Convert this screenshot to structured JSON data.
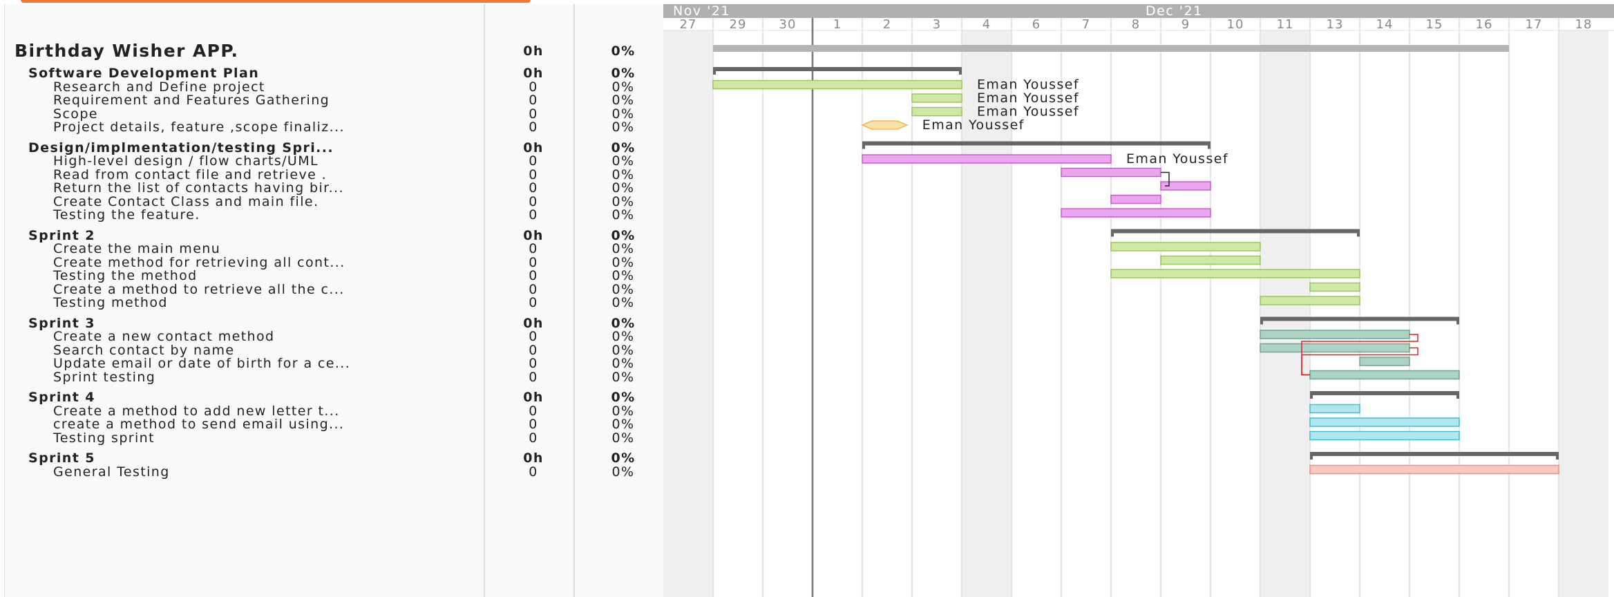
{
  "colors": {
    "summary": "#666666",
    "project_bar": "#b4b4b4",
    "green": "#cfe8a5",
    "green_border": "#97c85a",
    "pink": "#eba5ee",
    "pink_border": "#c65dcc",
    "teal": "#acd3c4",
    "teal_border": "#6fa592",
    "cyan": "#b2e5f0",
    "cyan_border": "#3cbfd4",
    "salmon": "#fbc8bf",
    "salmon_border": "#f08f82",
    "milestone": "#fde0a8",
    "milestone_border": "#f2b84d",
    "dependency": "#e02020",
    "weekend": "#efefef",
    "header": "#b0b0b0",
    "accent": "#f07a34"
  },
  "timeline": {
    "months": [
      {
        "label": "Nov '21",
        "day_index": 0
      },
      {
        "label": "Dec '21",
        "day_index": 9.5
      }
    ],
    "days": [
      "27",
      "29",
      "30",
      "1",
      "2",
      "3",
      "4",
      "6",
      "7",
      "8",
      "9",
      "10",
      "11",
      "13",
      "14",
      "15",
      "16",
      "17",
      "18"
    ],
    "weekend_columns": [
      0,
      6,
      12,
      18
    ],
    "today_column": 3
  },
  "tasks": [
    {
      "name": "Birthday Wisher APP.",
      "hours": "0h",
      "percent": "0%",
      "level": 0,
      "kind": "project",
      "start": 1,
      "end": 17
    },
    {
      "name": "Software Development Plan",
      "hours": "0h",
      "percent": "0%",
      "level": 1,
      "kind": "summary",
      "start": 1,
      "end": 6
    },
    {
      "name": "Research and Define project",
      "hours": "0",
      "percent": "0%",
      "level": 2,
      "kind": "bar",
      "color": "green",
      "start": 1,
      "end": 6,
      "resource": "Eman Youssef"
    },
    {
      "name": "Requirement and Features Gathering",
      "hours": "0",
      "percent": "0%",
      "level": 2,
      "kind": "bar",
      "color": "green",
      "start": 5,
      "end": 6,
      "resource": "Eman Youssef"
    },
    {
      "name": "Scope",
      "hours": "0",
      "percent": "0%",
      "level": 2,
      "kind": "bar",
      "color": "green",
      "start": 5,
      "end": 6,
      "resource": "Eman Youssef"
    },
    {
      "name": "Project details, feature ,scope finaliz...",
      "hours": "0",
      "percent": "0%",
      "level": 2,
      "kind": "milestone",
      "start": 4,
      "end": 4.9,
      "resource": "Eman Youssef"
    },
    {
      "name": "Design/implmentation/testing Spri...",
      "hours": "0h",
      "percent": "0%",
      "level": 1,
      "kind": "summary",
      "start": 4,
      "end": 11
    },
    {
      "name": "High-level design / flow charts/UML",
      "hours": "0",
      "percent": "0%",
      "level": 2,
      "kind": "bar",
      "color": "pink",
      "start": 4,
      "end": 9,
      "resource": "Eman Youssef"
    },
    {
      "name": " Read from contact file and retrieve .",
      "hours": "0",
      "percent": "0%",
      "level": 2,
      "kind": "bar",
      "color": "pink",
      "start": 8,
      "end": 10
    },
    {
      "name": "Return the list of contacts having bir...",
      "hours": "0",
      "percent": "0%",
      "level": 2,
      "kind": "bar",
      "color": "pink",
      "start": 10,
      "end": 11
    },
    {
      "name": "Create Contact Class and main file.",
      "hours": "0",
      "percent": "0%",
      "level": 2,
      "kind": "bar",
      "color": "pink",
      "start": 9,
      "end": 10
    },
    {
      "name": "Testing the feature.",
      "hours": "0",
      "percent": "0%",
      "level": 2,
      "kind": "bar",
      "color": "pink",
      "start": 8,
      "end": 11
    },
    {
      "name": "Sprint 2",
      "hours": "0h",
      "percent": "0%",
      "level": 1,
      "kind": "summary",
      "start": 9,
      "end": 14
    },
    {
      "name": "Create the main menu",
      "hours": "0",
      "percent": "0%",
      "level": 2,
      "kind": "bar",
      "color": "green",
      "start": 9,
      "end": 12
    },
    {
      "name": "Create method for retrieving all cont...",
      "hours": "0",
      "percent": "0%",
      "level": 2,
      "kind": "bar",
      "color": "green",
      "start": 10,
      "end": 12
    },
    {
      "name": "Testing the method",
      "hours": "0",
      "percent": "0%",
      "level": 2,
      "kind": "bar",
      "color": "green",
      "start": 9,
      "end": 14
    },
    {
      "name": "Create a method to retrieve all the c...",
      "hours": "0",
      "percent": "0%",
      "level": 2,
      "kind": "bar",
      "color": "green",
      "start": 13,
      "end": 14
    },
    {
      "name": "Testing method",
      "hours": "0",
      "percent": "0%",
      "level": 2,
      "kind": "bar",
      "color": "green",
      "start": 12,
      "end": 14
    },
    {
      "name": "Sprint 3",
      "hours": "0h",
      "percent": "0%",
      "level": 1,
      "kind": "summary",
      "start": 12,
      "end": 16
    },
    {
      "name": "Create a new contact method",
      "hours": "0",
      "percent": "0%",
      "level": 2,
      "kind": "bar",
      "color": "teal",
      "start": 12,
      "end": 15
    },
    {
      "name": "Search contact by name",
      "hours": "0",
      "percent": "0%",
      "level": 2,
      "kind": "bar",
      "color": "teal",
      "start": 12,
      "end": 15
    },
    {
      "name": "Update email or date of birth for a ce...",
      "hours": "0",
      "percent": "0%",
      "level": 2,
      "kind": "bar",
      "color": "teal",
      "start": 14,
      "end": 15
    },
    {
      "name": "Sprint testing",
      "hours": "0",
      "percent": "0%",
      "level": 2,
      "kind": "bar",
      "color": "teal",
      "start": 13,
      "end": 16
    },
    {
      "name": "Sprint 4",
      "hours": "0h",
      "percent": "0%",
      "level": 1,
      "kind": "summary",
      "start": 13,
      "end": 16
    },
    {
      "name": "Create a method to add new letter t...",
      "hours": "0",
      "percent": "0%",
      "level": 2,
      "kind": "bar",
      "color": "cyan",
      "start": 13,
      "end": 14
    },
    {
      "name": "create a method to send email using...",
      "hours": "0",
      "percent": "0%",
      "level": 2,
      "kind": "bar",
      "color": "cyan",
      "start": 13,
      "end": 16
    },
    {
      "name": "Testing sprint",
      "hours": "0",
      "percent": "0%",
      "level": 2,
      "kind": "bar",
      "color": "cyan",
      "start": 13,
      "end": 16
    },
    {
      "name": "Sprint 5",
      "hours": "0h",
      "percent": "0%",
      "level": 1,
      "kind": "summary",
      "start": 13,
      "end": 18
    },
    {
      "name": "General Testing",
      "hours": "0",
      "percent": "0%",
      "level": 2,
      "kind": "bar",
      "color": "salmon",
      "start": 13,
      "end": 18
    }
  ],
  "dependencies": [
    {
      "from": 8,
      "to": 9
    },
    {
      "from": 19,
      "to": 22
    },
    {
      "from": 20,
      "to": 22
    }
  ]
}
